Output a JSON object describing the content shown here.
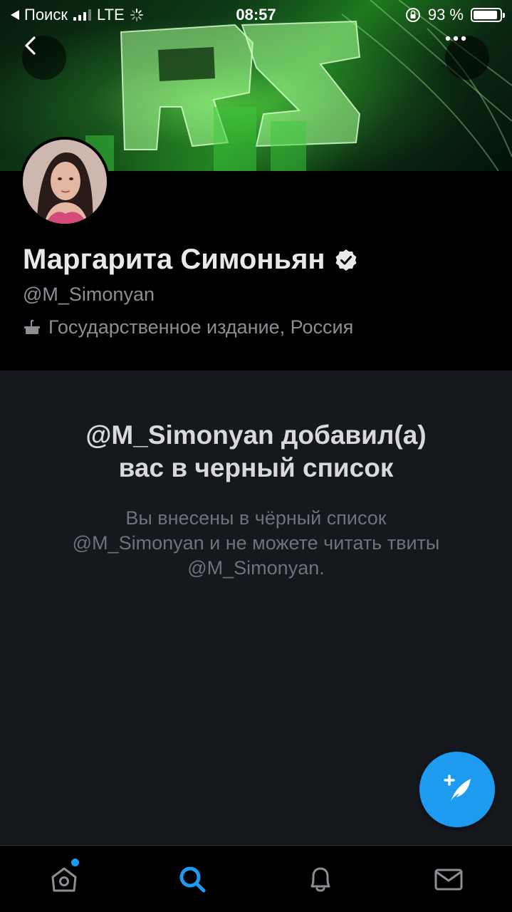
{
  "status_bar": {
    "back_app": "Поиск",
    "network": "LTE",
    "time": "08:57",
    "battery_percent": "93 %",
    "battery_level": 0.93
  },
  "profile": {
    "display_name": "Маргарита Симоньян",
    "handle": "@M_Simonyan",
    "affiliation": "Государственное издание, Россия",
    "verified": true
  },
  "blocked": {
    "title_lines": [
      "@M_Simonyan добавил(а)",
      "вас в черный список"
    ],
    "body_lines": [
      "Вы внесены в чёрный список",
      "@M_Simonyan и не можете читать твиты",
      "@M_Simonyan."
    ]
  },
  "icons": {
    "back": "chevron-left-icon",
    "more": "more-horizontal-icon",
    "compose": "compose-tweet-icon",
    "home": "home-icon",
    "search": "search-icon",
    "notifications": "bell-icon",
    "messages": "envelope-icon",
    "verified": "verified-badge-icon",
    "affiliation": "podium-icon"
  },
  "colors": {
    "accent": "#1d9bf0",
    "background": "#15181d",
    "header_background": "#000000"
  }
}
